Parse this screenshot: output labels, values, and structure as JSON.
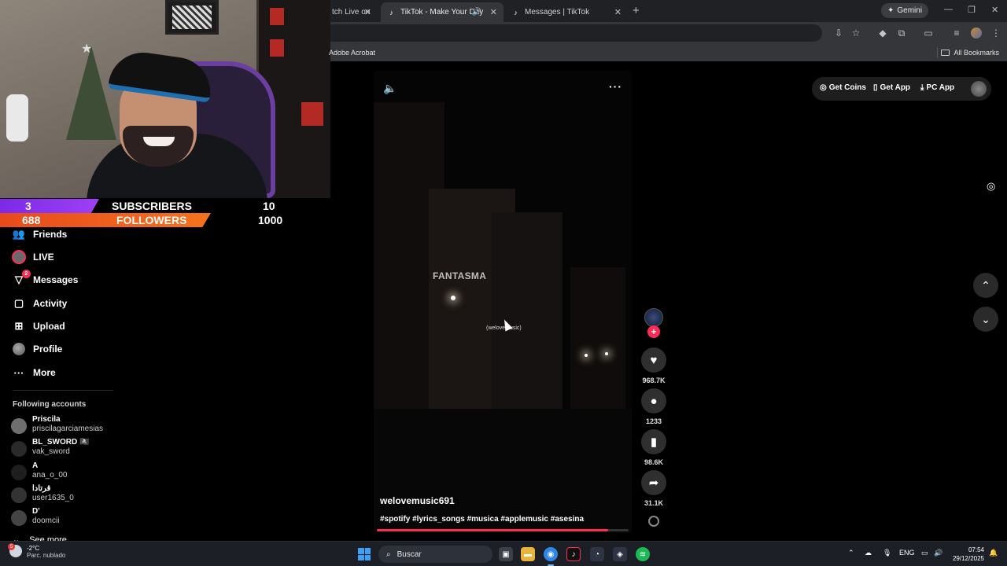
{
  "browser": {
    "tabs": [
      {
        "label": "tch Live on",
        "active": false
      },
      {
        "label": "TikTok - Make Your Day",
        "active": true
      },
      {
        "label": "Messages | TikTok",
        "active": false
      }
    ],
    "gemini_label": "Gemini",
    "bookmarks_left": "Adobe Acrobat",
    "bookmarks_right": "All Bookmarks"
  },
  "stream_overlay": {
    "subscribers_count": "3",
    "subscribers_label": "SUBSCRIBERS",
    "subscribers_goal": "10",
    "followers_count": "688",
    "followers_label": "FOLLOWERS",
    "followers_goal": "1000"
  },
  "nav": {
    "items": [
      {
        "label": "Friends",
        "icon": "friends-icon"
      },
      {
        "label": "LIVE",
        "icon": "live-icon"
      },
      {
        "label": "Messages",
        "icon": "messages-icon",
        "badge": "2"
      },
      {
        "label": "Activity",
        "icon": "activity-icon"
      },
      {
        "label": "Upload",
        "icon": "upload-icon"
      },
      {
        "label": "Profile",
        "icon": "profile-icon"
      },
      {
        "label": "More",
        "icon": "more-icon"
      }
    ],
    "following_title": "Following accounts",
    "accounts": [
      {
        "name": "Priscila",
        "handle": "priscilagarciamesias"
      },
      {
        "name": "BL_SWORD 🏴‍☠️",
        "handle": "vak_sword"
      },
      {
        "name": "A",
        "handle": "ana_o_00"
      },
      {
        "name": "قرتادا",
        "handle": "user1635_0"
      },
      {
        "name": "D'",
        "handle": "doomcii"
      }
    ],
    "see_more": "See more"
  },
  "video": {
    "overlay_title": "FANTASMA",
    "overlay_subtitle": "(welovemusic)",
    "username": "welovemusic691",
    "hashtags": "#spotify #lyrics_songs #musica #applemusic #asesina",
    "progress": 0.92
  },
  "actions": {
    "likes": "968.7K",
    "comments": "1233",
    "saves": "98.6K",
    "shares": "31.1K"
  },
  "header": {
    "get_coins": "Get Coins",
    "get_app": "Get App",
    "pc_app": "PC App"
  },
  "taskbar": {
    "temperature": "-2°C",
    "weather": "Parc. nublado",
    "weather_badge": "5",
    "search_placeholder": "Buscar",
    "language": "ENG",
    "time": "07:54",
    "date": "29/12/2025"
  },
  "colors": {
    "accent": "#fe2c55",
    "subscribers": "#8a33ee",
    "followers": "#ee5a1c"
  }
}
